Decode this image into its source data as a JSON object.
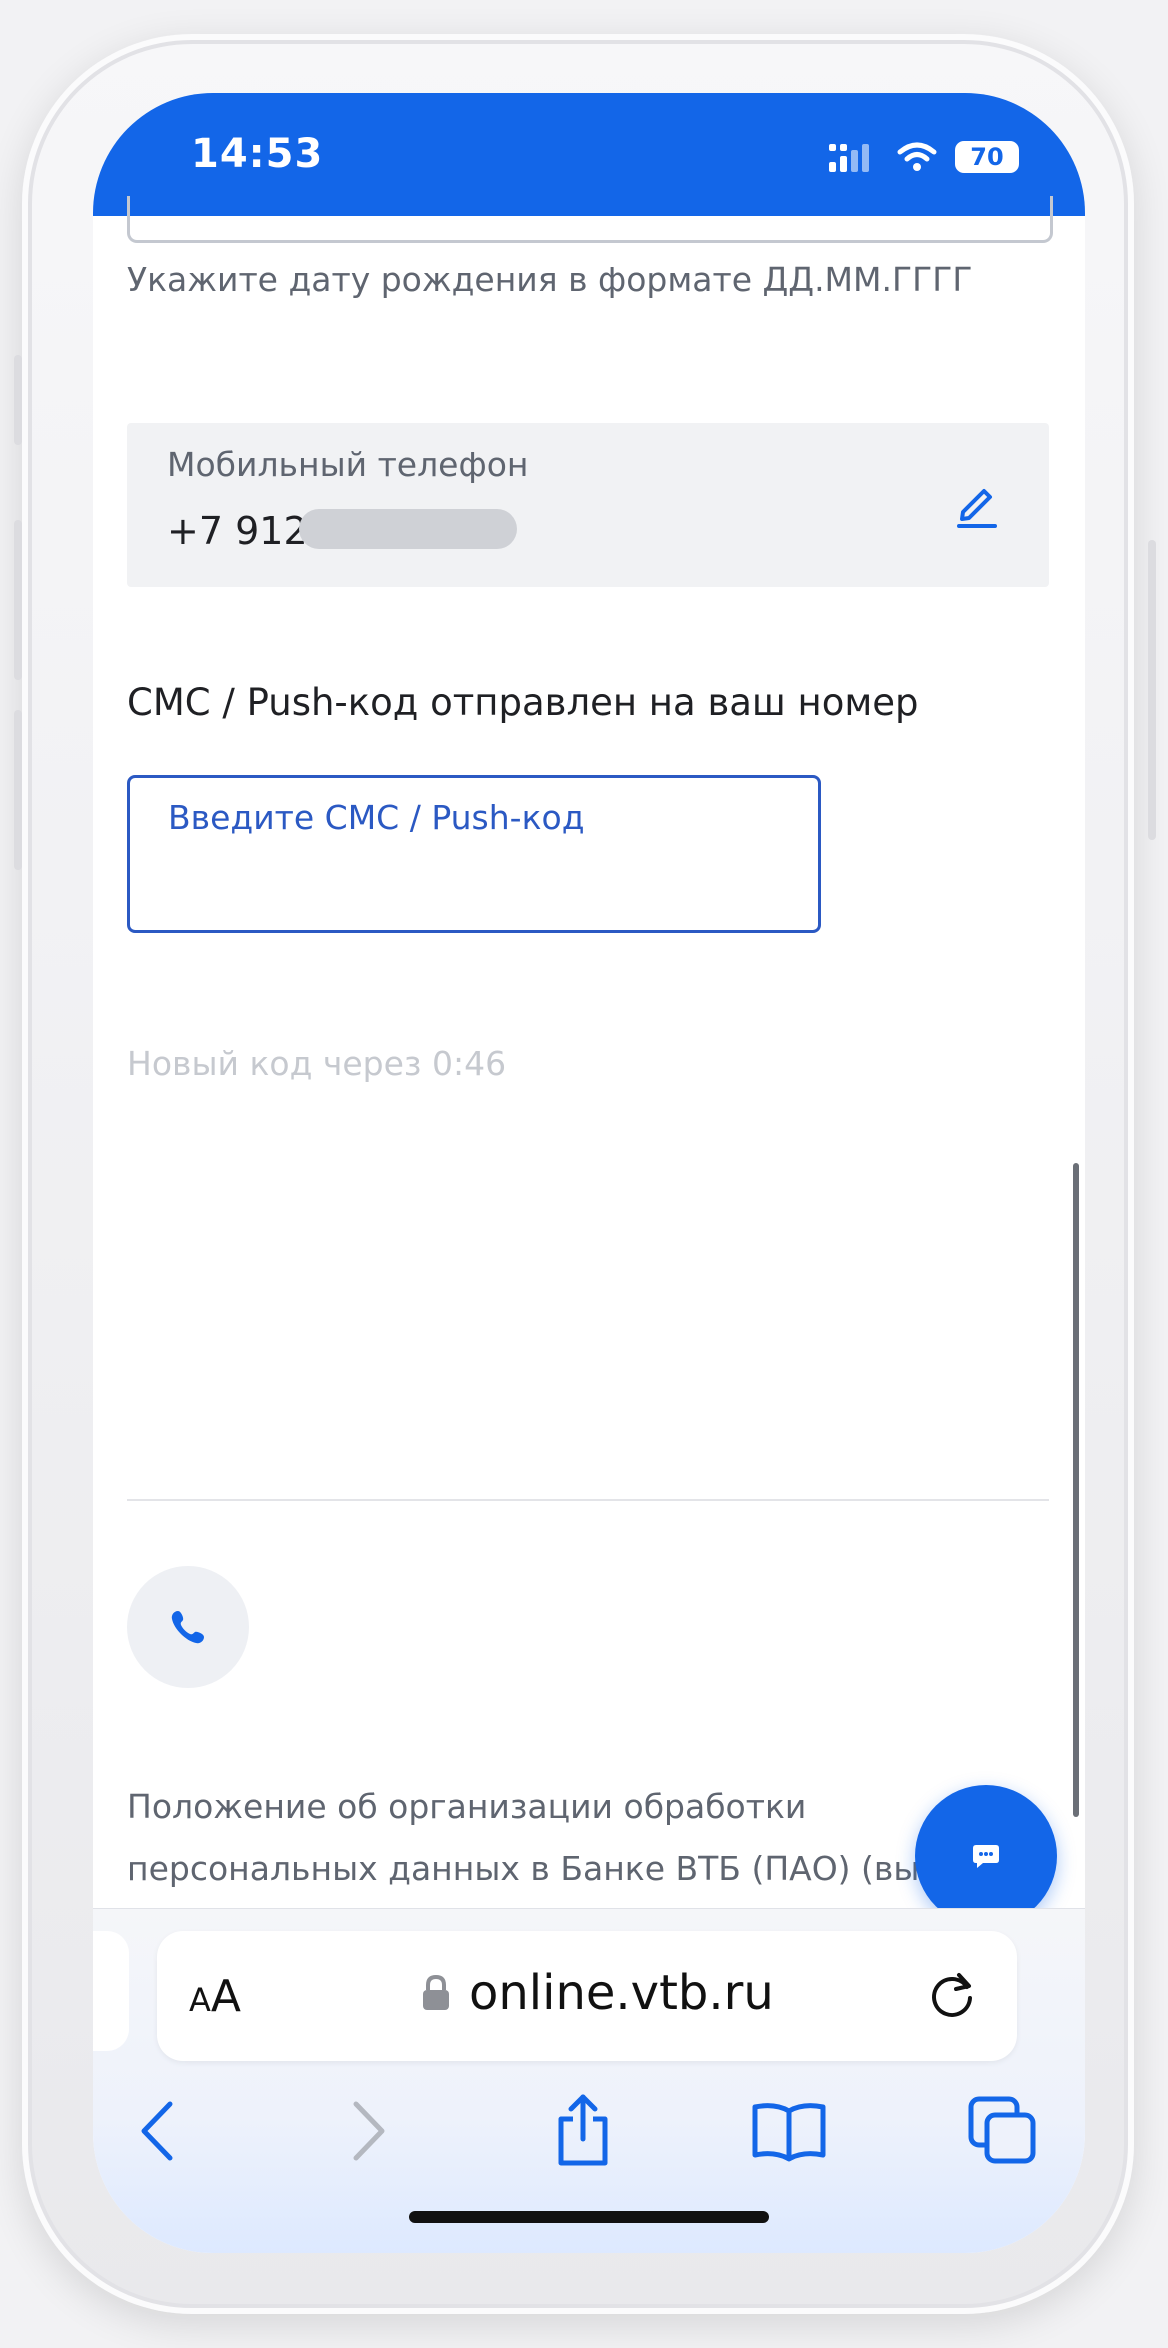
{
  "status_bar": {
    "time": "14:53",
    "battery": "70",
    "accent_color": "#1366e8"
  },
  "form": {
    "birthdate_hint": "Укажите дату рождения в формате ДД.ММ.ГГГГ",
    "phone": {
      "label": "Мобильный телефон",
      "value_visible": "+7 912",
      "edit_icon": "pencil-icon"
    },
    "sms": {
      "title": "СМС / Push-код отправлен на ваш номер",
      "placeholder": "Введите СМС / Push-код",
      "value": ""
    },
    "resend_timer": "Новый код через 0:46"
  },
  "footer": {
    "call_icon": "phone-icon",
    "policy_line1": "Положение об организации обработки",
    "policy_line2": "персональных данных в Банке ВТБ (ПАО) (вы",
    "chat_icon": "chat-bubble-icon"
  },
  "browser": {
    "text_size_label": "AA",
    "url": "online.vtb.ru",
    "lock_icon": "lock-icon",
    "reload_icon": "reload-icon",
    "toolbar_icons": [
      "back-icon",
      "forward-icon",
      "share-icon",
      "bookmarks-icon",
      "tabs-icon"
    ]
  }
}
